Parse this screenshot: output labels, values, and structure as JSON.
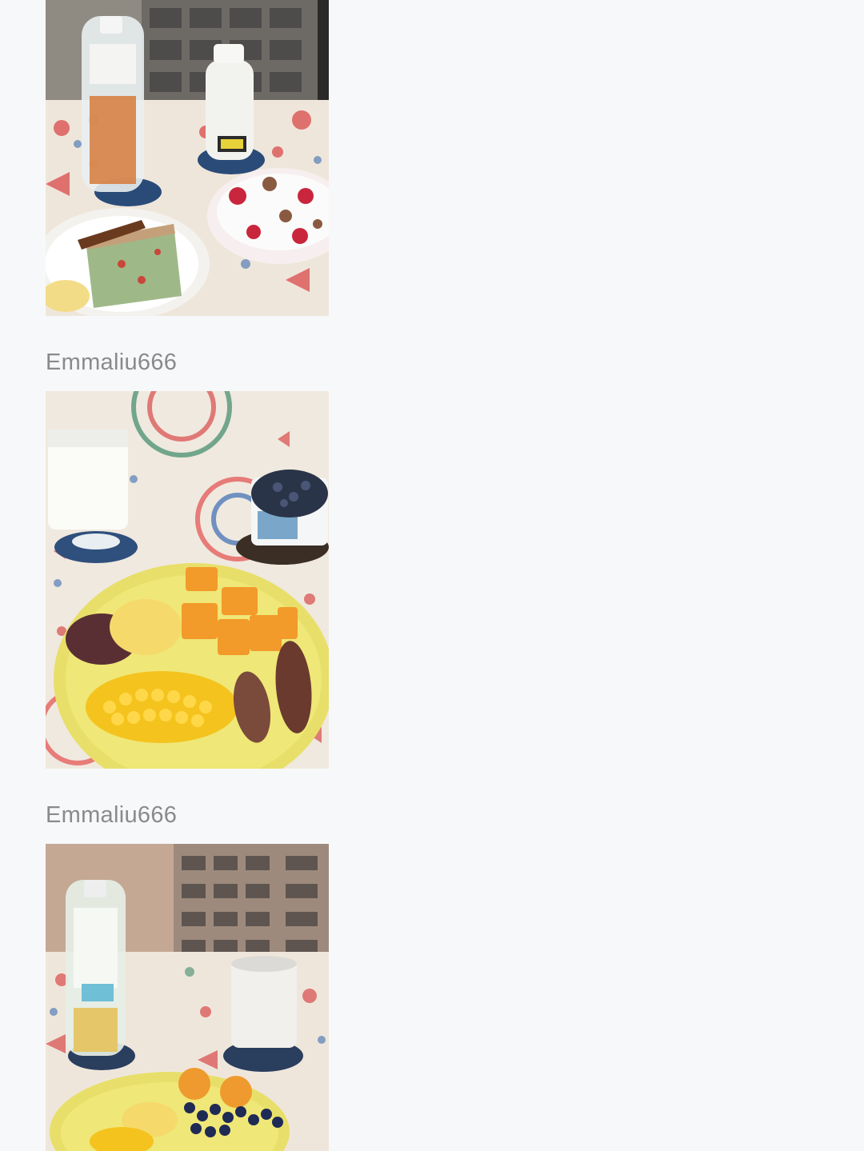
{
  "feed": {
    "posts": [
      {
        "photo_alt": "Breakfast: oolong tea bottle, milk bottle, yogurt bowl with raspberries, bread slice"
      },
      {
        "author": "Emmaliu666",
        "photo_alt": "Breakfast: glass of milk, yogurt cup with blueberries, plate with orange, egg, beans, corn and sweet potatoes"
      },
      {
        "author": "Emmaliu666",
        "photo_alt": "Breakfast: jasmine tea bottle, milk glass, plate with apricots, blueberries, egg and corn"
      }
    ]
  },
  "colors": {
    "background": "#f7f8fa",
    "author_text": "#8a8a8a"
  }
}
